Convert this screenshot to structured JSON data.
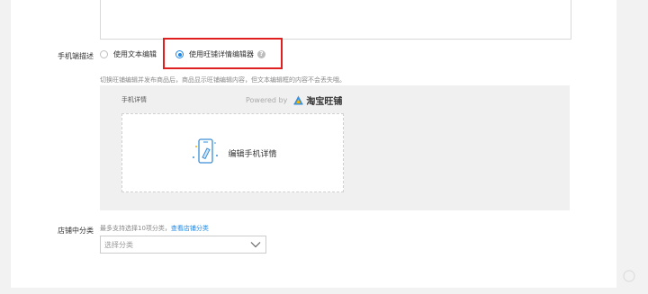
{
  "form": {
    "mobile_desc_label": "手机端描述",
    "radio_text_editor": "使用文本编辑",
    "radio_wangpu_editor": "使用旺铺详情编辑器",
    "hint": "切换旺铺编辑并发布商品后，商品显示旺铺编辑内容，但文本编辑框的内容不会丢失哦。",
    "editor_title": "手机详情",
    "powered_by": "Powered by",
    "brand_name": "淘宝旺铺",
    "edit_mobile_detail": "编辑手机详情",
    "category_label": "店铺中分类",
    "category_hint": "最多支持选择10项分类，",
    "category_link": "查看店铺分类",
    "category_placeholder": "选择分类"
  },
  "colors": {
    "accent": "#1e88e5",
    "highlight_box": "#e02020"
  },
  "icons": [
    "help-icon",
    "taobao-wangpu-logo",
    "phone-edit-icon",
    "chevron-down-icon"
  ]
}
